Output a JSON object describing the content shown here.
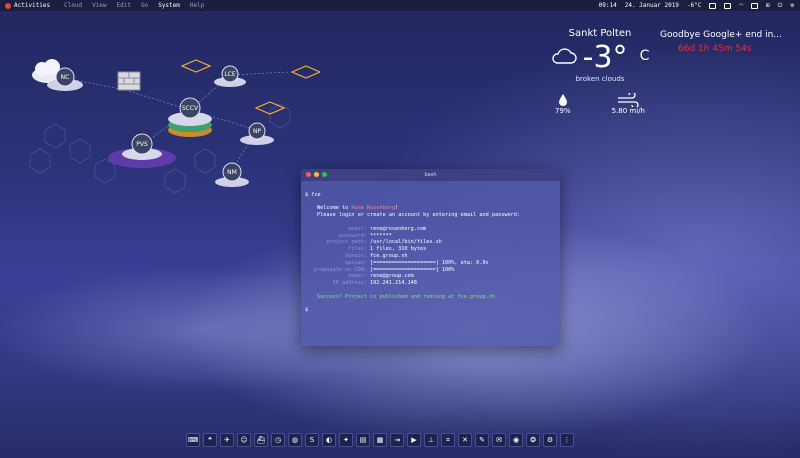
{
  "topbar": {
    "activities_label": "Activities",
    "menu": [
      {
        "label": "Cloud"
      },
      {
        "label": "View"
      },
      {
        "label": "Edit"
      },
      {
        "label": "Go"
      },
      {
        "label": "System",
        "active": true
      },
      {
        "label": "Help"
      }
    ],
    "time": "09:14",
    "date": "24. Januar 2019",
    "temp_small": "-6°C",
    "tray_icons": [
      "printer-icon",
      "chat-icon",
      "wifi-icon",
      "display-icon",
      "network-icon",
      "power-icon",
      "settings-icon"
    ]
  },
  "diagram": {
    "nodes": [
      {
        "id": "nc",
        "label": "NC"
      },
      {
        "id": "lce",
        "label": "LCE"
      },
      {
        "id": "sccv",
        "label": "SCCV"
      },
      {
        "id": "np",
        "label": "NP"
      },
      {
        "id": "pvs",
        "label": "PVS"
      },
      {
        "id": "nm",
        "label": "NM"
      }
    ],
    "accent": "#f0b429"
  },
  "weather": {
    "city": "Sankt Polten",
    "temperature": "-3°",
    "unit": "C",
    "description": "broken clouds",
    "humidity": "79%",
    "wind": "5.80 mi/h",
    "icon": "cloud-icon"
  },
  "countdown": {
    "title": "Goodbye Google+ end in...",
    "remaining": "66d 1h 45m 54s",
    "color": "#e53030"
  },
  "terminal": {
    "title": "bash",
    "prompt_cmd": "$ fce",
    "welcome_prefix": "Welcome to ",
    "welcome_name": "Rene Rosenberg",
    "welcome_suffix": "!",
    "login_line": "Please login or create an account by entering email and password:",
    "rows": [
      {
        "key": "email:",
        "value": "rene@rosenberg.com"
      },
      {
        "key": "password:",
        "value": "*******"
      },
      {
        "key": "project path:",
        "value": "/usr/local/bin/files.sh"
      },
      {
        "key": "files:",
        "value": "1 files, 310 bytes"
      },
      {
        "key": "domain:",
        "value": "fce.group.sh"
      },
      {
        "key": "upload:",
        "value": "[====================] 100%, eta: 0.9s"
      },
      {
        "key": "propagate on CDN:",
        "value": "[====================] 100%"
      },
      {
        "key": "owner:",
        "value": "rene@group.com"
      },
      {
        "key": "IP address:",
        "value": "192.241.214.148"
      }
    ],
    "success": "Success! Project is published and running at fce.group.sh",
    "final_prompt": "$"
  },
  "dock": {
    "items": [
      {
        "icon": "keyboard-icon",
        "glyph": "⌨"
      },
      {
        "icon": "quote-icon",
        "glyph": "❝"
      },
      {
        "icon": "airplane-icon",
        "glyph": "✈"
      },
      {
        "icon": "users-icon",
        "glyph": "☺"
      },
      {
        "icon": "ship-icon",
        "glyph": "⛴"
      },
      {
        "icon": "clock-icon",
        "glyph": "◷"
      },
      {
        "icon": "globe-icon",
        "glyph": "◍"
      },
      {
        "icon": "skype-icon",
        "glyph": "S"
      },
      {
        "icon": "contrast-icon",
        "glyph": "◐"
      },
      {
        "icon": "twitter-icon",
        "glyph": "✦"
      },
      {
        "icon": "document-icon",
        "glyph": "▤"
      },
      {
        "icon": "calculator-icon",
        "glyph": "▦"
      },
      {
        "icon": "exit-icon",
        "glyph": "⇥"
      },
      {
        "icon": "youtube-icon",
        "glyph": "▶"
      },
      {
        "icon": "stamp-icon",
        "glyph": "⊥"
      },
      {
        "icon": "crop-icon",
        "glyph": "⌗"
      },
      {
        "icon": "tools-icon",
        "glyph": "✕"
      },
      {
        "icon": "wrench-icon",
        "glyph": "✎"
      },
      {
        "icon": "mail-icon",
        "glyph": "✉"
      },
      {
        "icon": "chrome-icon",
        "glyph": "◉"
      },
      {
        "icon": "firefox-icon",
        "glyph": "❂"
      },
      {
        "icon": "settings-icon",
        "glyph": "⚙"
      },
      {
        "icon": "apps-grid-icon",
        "glyph": "⋮"
      }
    ]
  }
}
